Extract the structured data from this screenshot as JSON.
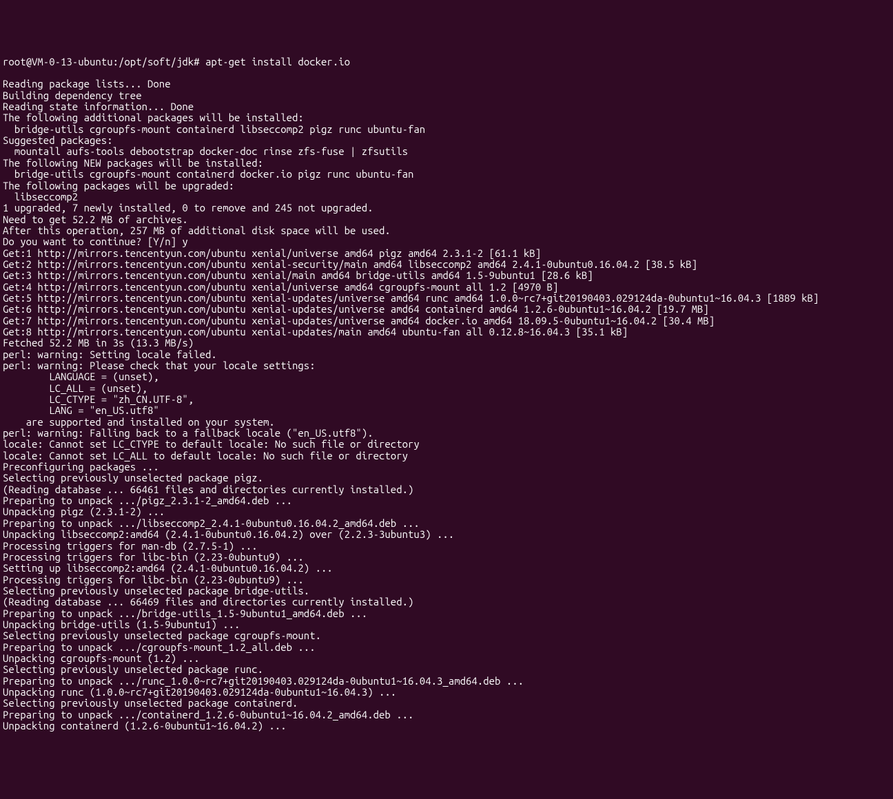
{
  "terminal": {
    "prompt": {
      "user_host": "root@VM-0-13-ubuntu",
      "path": ":/opt/soft/jdk#",
      "command": " apt-get install docker.io"
    },
    "lines": [
      "Reading package lists... Done",
      "Building dependency tree",
      "Reading state information... Done",
      "The following additional packages will be installed:",
      "  bridge-utils cgroupfs-mount containerd libseccomp2 pigz runc ubuntu-fan",
      "Suggested packages:",
      "  mountall aufs-tools debootstrap docker-doc rinse zfs-fuse | zfsutils",
      "The following NEW packages will be installed:",
      "  bridge-utils cgroupfs-mount containerd docker.io pigz runc ubuntu-fan",
      "The following packages will be upgraded:",
      "  libseccomp2",
      "1 upgraded, 7 newly installed, 0 to remove and 245 not upgraded.",
      "Need to get 52.2 MB of archives.",
      "After this operation, 257 MB of additional disk space will be used.",
      "Do you want to continue? [Y/n] y",
      "Get:1 http://mirrors.tencentyun.com/ubuntu xenial/universe amd64 pigz amd64 2.3.1-2 [61.1 kB]",
      "Get:2 http://mirrors.tencentyun.com/ubuntu xenial-security/main amd64 libseccomp2 amd64 2.4.1-0ubuntu0.16.04.2 [38.5 kB]",
      "Get:3 http://mirrors.tencentyun.com/ubuntu xenial/main amd64 bridge-utils amd64 1.5-9ubuntu1 [28.6 kB]",
      "Get:4 http://mirrors.tencentyun.com/ubuntu xenial/universe amd64 cgroupfs-mount all 1.2 [4970 B]",
      "Get:5 http://mirrors.tencentyun.com/ubuntu xenial-updates/universe amd64 runc amd64 1.0.0~rc7+git20190403.029124da-0ubuntu1~16.04.3 [1889 kB]",
      "Get:6 http://mirrors.tencentyun.com/ubuntu xenial-updates/universe amd64 containerd amd64 1.2.6-0ubuntu1~16.04.2 [19.7 MB]",
      "Get:7 http://mirrors.tencentyun.com/ubuntu xenial-updates/universe amd64 docker.io amd64 18.09.5-0ubuntu1~16.04.2 [30.4 MB]",
      "Get:8 http://mirrors.tencentyun.com/ubuntu xenial-updates/main amd64 ubuntu-fan all 0.12.8~16.04.3 [35.1 kB]",
      "Fetched 52.2 MB in 3s (13.3 MB/s)",
      "perl: warning: Setting locale failed.",
      "perl: warning: Please check that your locale settings:",
      "        LANGUAGE = (unset),",
      "        LC_ALL = (unset),",
      "        LC_CTYPE = \"zh_CN.UTF-8\",",
      "        LANG = \"en_US.utf8\"",
      "    are supported and installed on your system.",
      "perl: warning: Falling back to a fallback locale (\"en_US.utf8\").",
      "locale: Cannot set LC_CTYPE to default locale: No such file or directory",
      "locale: Cannot set LC_ALL to default locale: No such file or directory",
      "Preconfiguring packages ...",
      "Selecting previously unselected package pigz.",
      "(Reading database ... 66461 files and directories currently installed.)",
      "Preparing to unpack .../pigz_2.3.1-2_amd64.deb ...",
      "Unpacking pigz (2.3.1-2) ...",
      "Preparing to unpack .../libseccomp2_2.4.1-0ubuntu0.16.04.2_amd64.deb ...",
      "Unpacking libseccomp2:amd64 (2.4.1-0ubuntu0.16.04.2) over (2.2.3-3ubuntu3) ...",
      "Processing triggers for man-db (2.7.5-1) ...",
      "Processing triggers for libc-bin (2.23-0ubuntu9) ...",
      "Setting up libseccomp2:amd64 (2.4.1-0ubuntu0.16.04.2) ...",
      "Processing triggers for libc-bin (2.23-0ubuntu9) ...",
      "Selecting previously unselected package bridge-utils.",
      "(Reading database ... 66469 files and directories currently installed.)",
      "Preparing to unpack .../bridge-utils_1.5-9ubuntu1_amd64.deb ...",
      "Unpacking bridge-utils (1.5-9ubuntu1) ...",
      "Selecting previously unselected package cgroupfs-mount.",
      "Preparing to unpack .../cgroupfs-mount_1.2_all.deb ...",
      "Unpacking cgroupfs-mount (1.2) ...",
      "Selecting previously unselected package runc.",
      "Preparing to unpack .../runc_1.0.0~rc7+git20190403.029124da-0ubuntu1~16.04.3_amd64.deb ...",
      "Unpacking runc (1.0.0~rc7+git20190403.029124da-0ubuntu1~16.04.3) ...",
      "Selecting previously unselected package containerd.",
      "Preparing to unpack .../containerd_1.2.6-0ubuntu1~16.04.2_amd64.deb ...",
      "Unpacking containerd (1.2.6-0ubuntu1~16.04.2) ..."
    ]
  }
}
